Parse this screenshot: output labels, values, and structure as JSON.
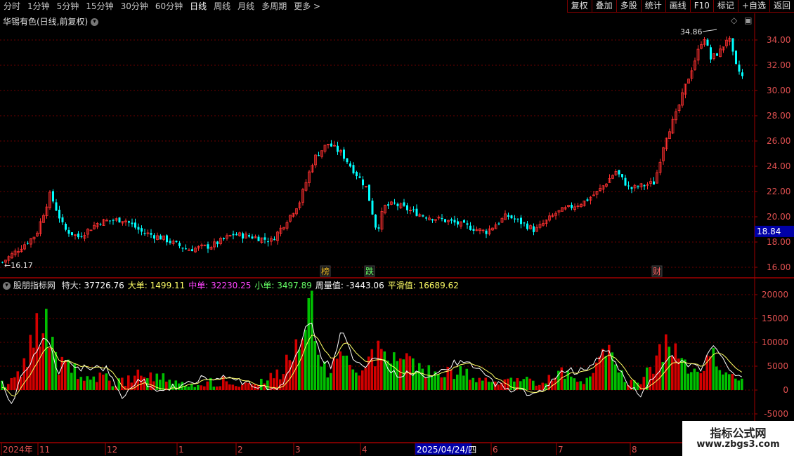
{
  "toolbar": {
    "periods": [
      "分时",
      "1分钟",
      "5分钟",
      "15分钟",
      "30分钟",
      "60分钟",
      "日线",
      "周线",
      "月线",
      "多周期",
      "更多"
    ],
    "active_period": "日线",
    "more_arrow": ">",
    "right_buttons": [
      "复权",
      "叠加",
      "多股",
      "统计",
      "画线",
      "F10",
      "标记",
      "+自选",
      "返回"
    ]
  },
  "main_chart": {
    "title": "华锡有色(日线,前复权)",
    "price_axis": [
      "34.00",
      "32.00",
      "30.00",
      "28.00",
      "26.00",
      "24.00",
      "22.00",
      "20.00",
      "18.00",
      "16.00"
    ],
    "high_label": "34.86",
    "low_label": "16.17",
    "current_price": "18.84",
    "event_markers": [
      {
        "text": "榜",
        "color": "#e6b422"
      },
      {
        "text": "跌",
        "color": "#66ff66"
      },
      {
        "text": "财",
        "color": "#ff6666"
      }
    ]
  },
  "indicator": {
    "name": "股朋指标网",
    "items": [
      {
        "label": "特大:",
        "value": "37726.76",
        "color": "#ffffff"
      },
      {
        "label": "大单:",
        "value": "1499.11",
        "color": "#ffff66"
      },
      {
        "label": "中单:",
        "value": "32230.25",
        "color": "#ff44ff"
      },
      {
        "label": "小单:",
        "value": "3497.89",
        "color": "#66ff66"
      },
      {
        "label": "周量值:",
        "value": "-3443.06",
        "color": "#ffffff"
      },
      {
        "label": "平滑值:",
        "value": "16689.62",
        "color": "#ffff66"
      }
    ],
    "axis": [
      "20000",
      "15000",
      "10000",
      "5000",
      "0",
      "-5000"
    ]
  },
  "date_axis": {
    "labels": [
      "2024年",
      "11",
      "12",
      "1",
      "2",
      "3",
      "4",
      "2025/04/24/四",
      "6",
      "7",
      "8"
    ],
    "highlight": "2025/04/24/四"
  },
  "watermark": {
    "line1": "指标公式网",
    "line2": "www.zbgs3.com"
  },
  "colors": {
    "up": "#ff3030",
    "down": "#00ffff",
    "bar_up": "#d40000",
    "bar_down": "#00c000",
    "grid": "#6b0000"
  },
  "icons": [
    "eye-icon",
    "diamond-icon",
    "window-icon",
    "chevron-right-icon"
  ]
}
